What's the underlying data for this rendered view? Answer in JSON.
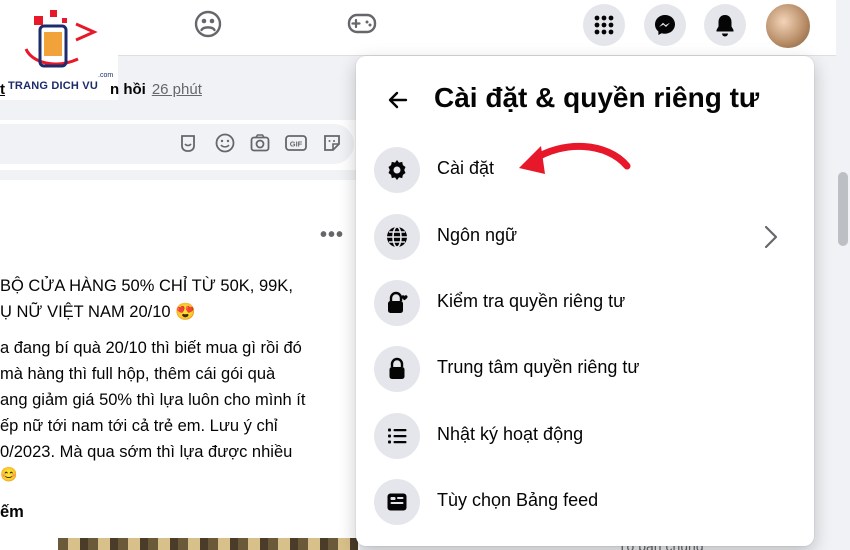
{
  "logo": {
    "text": "TRANG DICH VU",
    "domain": ".com"
  },
  "feed": {
    "meta_tail": "n hồi",
    "meta_prefix": "t",
    "time": "26 phút",
    "post_lines": [
      "BỘ CỬA HÀNG 50% CHỈ TỪ 50K, 99K,",
      "Ụ NỮ VIỆT NAM 20/10 😍",
      "a đang bí quà 20/10 thì biết mua gì rồi đó",
      "mà hàng thì full hộp, thêm cái gói quà",
      "ang giảm giá 50% thì lựa luôn cho mình ít",
      "ếp nữ tới nam tới cả trẻ em. Lưu ý chỉ",
      "0/2023. Mà qua sớm thì lựa được nhiều",
      "😊",
      "ếm"
    ],
    "more_label": "•••",
    "partial_caption": "Tổ bạn chung"
  },
  "panel": {
    "title": "Cài đặt & quyền riêng tư",
    "items": [
      {
        "label": "Cài đặt",
        "icon": "gear-icon"
      },
      {
        "label": "Ngôn ngữ",
        "icon": "globe-icon"
      },
      {
        "label": "Kiểm tra quyền riêng tư",
        "icon": "lock-heart-icon"
      },
      {
        "label": "Trung tâm quyền riêng tư",
        "icon": "lock-icon"
      },
      {
        "label": "Nhật ký hoạt động",
        "icon": "list-icon"
      },
      {
        "label": "Tùy chọn Bảng feed",
        "icon": "feed-icon"
      }
    ]
  },
  "colors": {
    "annotation_arrow": "#e8182b",
    "panel_bg": "#ffffff",
    "icon_circle": "#e4e6eb"
  }
}
